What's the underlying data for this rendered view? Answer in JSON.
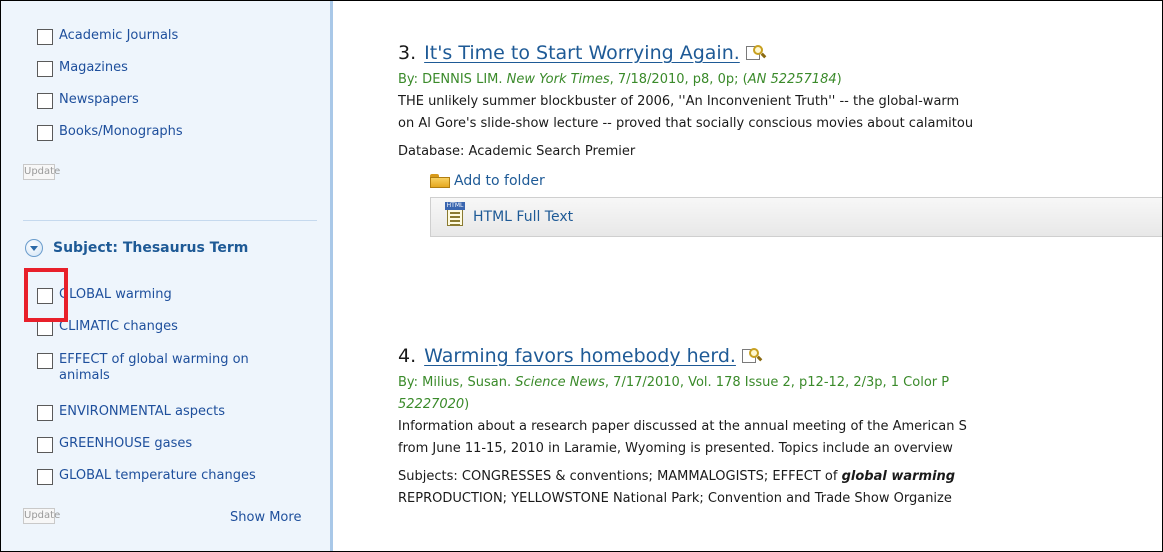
{
  "sidebar": {
    "source_types": [
      {
        "label": "Academic Journals"
      },
      {
        "label": "Magazines"
      },
      {
        "label": "Newspapers"
      },
      {
        "label": "Books/Monographs"
      }
    ],
    "update_label": "Update",
    "subject_heading": "Subject: Thesaurus Term",
    "subject_terms": [
      {
        "label": "GLOBAL warming"
      },
      {
        "label": "CLIMATIC changes"
      },
      {
        "label": "EFFECT of global warming on animals"
      },
      {
        "label": "ENVIRONMENTAL aspects"
      },
      {
        "label": "GREENHOUSE gases"
      },
      {
        "label": "GLOBAL temperature changes"
      }
    ],
    "show_more_label": "Show More",
    "highlight_color": "#e8202a"
  },
  "results": [
    {
      "number": "3.",
      "title": "It's Time to Start Worrying Again.",
      "cite_prefix": "By: DENNIS LIM. ",
      "source": "New York Times",
      "cite_details": ", 7/18/2010, p8, 0p; (",
      "accession": "AN 52257184",
      "cite_close": ")",
      "abstract_line1": "THE unlikely summer blockbuster of 2006, ''An Inconvenient Truth'' -- the global-warm",
      "abstract_line2": "on Al Gore's slide-show lecture -- proved that socially conscious movies about calamitou",
      "database": "Database: Academic Search Premier",
      "folder_label": "Add to folder",
      "fulltext_label": "HTML Full Text",
      "fulltext_icon_tag": "HTML"
    },
    {
      "number": "4.",
      "title": "Warming favors homebody herd.",
      "cite_prefix": "By: Milius, Susan. ",
      "source": "Science News",
      "cite_details": ", 7/17/2010, Vol. 178 Issue 2, p12-12, 2/3p, 1 Color P",
      "accession_line2": "52227020",
      "cite_close": ")",
      "abstract_line1": "Information about a research paper discussed at the annual meeting of the American S",
      "abstract_line2": "from June 11-15, 2010 in Laramie, Wyoming is presented. Topics include an overview",
      "subjects_prefix": "Subjects: CONGRESSES & conventions; MAMMALOGISTS; EFFECT of ",
      "subjects_bold": "global warming",
      "subjects_line2": "REPRODUCTION; YELLOWSTONE National Park; Convention and Trade Show Organize"
    }
  ],
  "colors": {
    "link": "#1e5a96",
    "citation": "#3a8a2a",
    "sidebar_bg": "#eef5fc"
  }
}
